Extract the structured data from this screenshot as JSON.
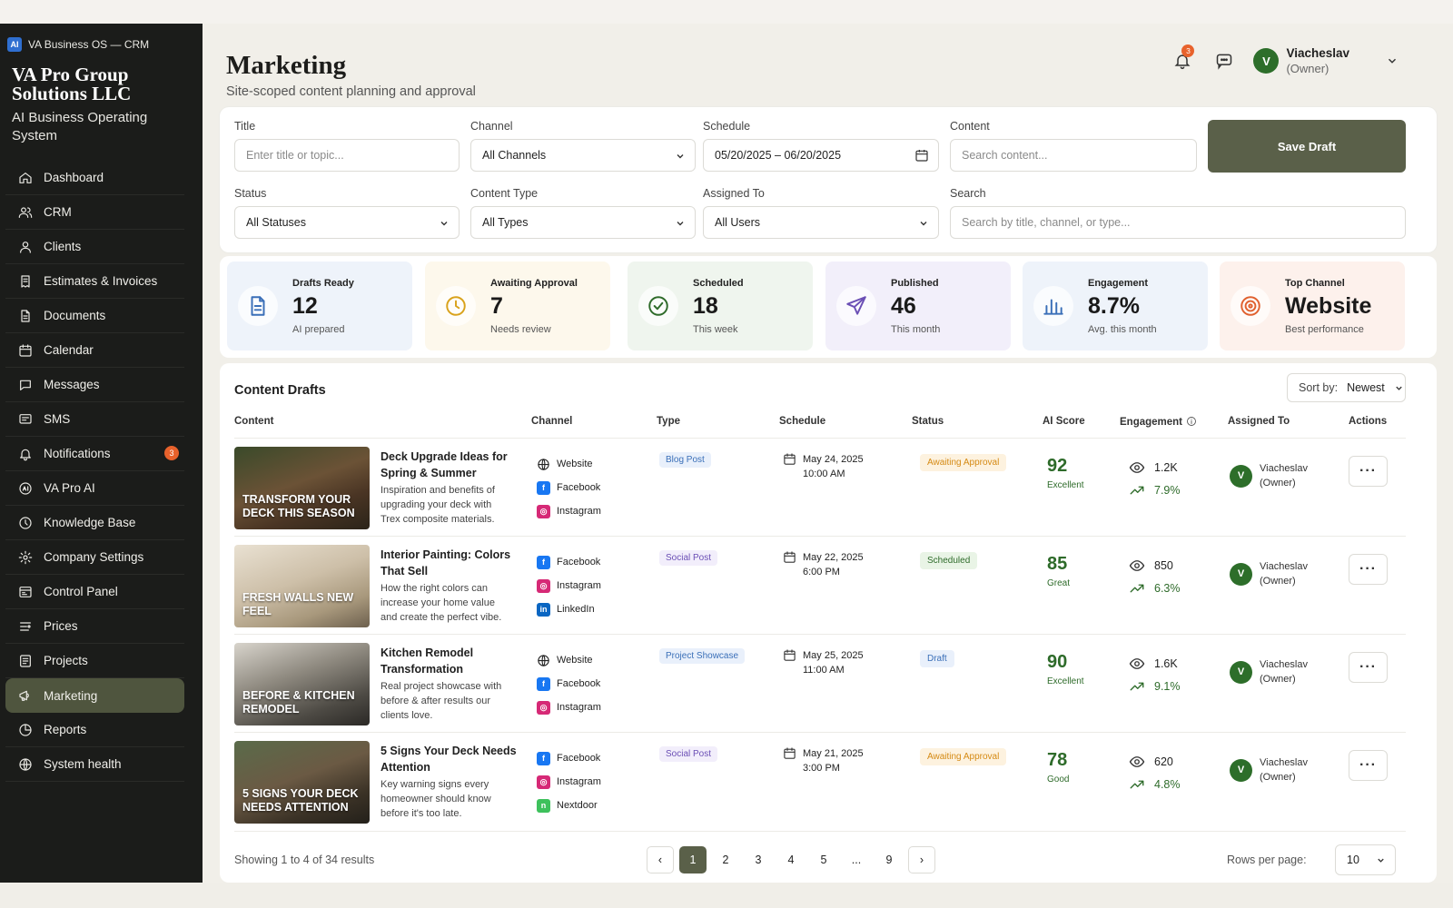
{
  "app": {
    "title": "VA Business OS — CRM",
    "logo_text": "AI",
    "company": "VA Pro Group Solutions LLC",
    "tagline": "AI Business Operating System"
  },
  "sidebar": {
    "items": [
      {
        "label": "Dashboard",
        "icon": "home-icon"
      },
      {
        "label": "CRM",
        "icon": "users-icon"
      },
      {
        "label": "Clients",
        "icon": "clients-icon"
      },
      {
        "label": "Estimates & Invoices",
        "icon": "invoice-icon"
      },
      {
        "label": "Documents",
        "icon": "document-icon"
      },
      {
        "label": "Calendar",
        "icon": "calendar-icon"
      },
      {
        "label": "Messages",
        "icon": "message-icon"
      },
      {
        "label": "SMS",
        "icon": "sms-icon"
      },
      {
        "label": "Notifications",
        "icon": "bell-icon",
        "badge": "3"
      },
      {
        "label": "VA Pro AI",
        "icon": "ai-icon"
      },
      {
        "label": "Knowledge Base",
        "icon": "knowledge-icon"
      },
      {
        "label": "Company Settings",
        "icon": "gear-icon"
      },
      {
        "label": "Control Panel",
        "icon": "control-icon"
      },
      {
        "label": "Prices",
        "icon": "prices-icon"
      },
      {
        "label": "Projects",
        "icon": "projects-icon"
      },
      {
        "label": "Marketing",
        "icon": "megaphone-icon",
        "active": true
      },
      {
        "label": "Reports",
        "icon": "reports-icon"
      },
      {
        "label": "System health",
        "icon": "health-icon"
      }
    ]
  },
  "header": {
    "title": "Marketing",
    "subtitle": "Site-scoped content planning and approval",
    "notif_count": "3",
    "user_initial": "V",
    "user_name": "Viacheslav",
    "user_role": "(Owner)"
  },
  "filters": {
    "title_label": "Title",
    "title_placeholder": "Enter title or topic...",
    "channel_label": "Channel",
    "channel_value": "All Channels",
    "schedule_label": "Schedule",
    "schedule_value": "05/20/2025 – 06/20/2025",
    "content_label": "Content",
    "content_placeholder": "Search content...",
    "status_label": "Status",
    "status_value": "All Statuses",
    "type_label": "Content Type",
    "type_value": "All Types",
    "assigned_label": "Assigned To",
    "assigned_value": "All Users",
    "search_label": "Search",
    "search_placeholder": "Search by title, channel, or type...",
    "save_label": "Save Draft"
  },
  "stats": [
    {
      "label": "Drafts Ready",
      "value": "12",
      "sub": "AI prepared",
      "icon": "document-icon",
      "bg": "#eef3fa",
      "ic": "#3a6fb8"
    },
    {
      "label": "Awaiting Approval",
      "value": "7",
      "sub": "Needs review",
      "icon": "clock-icon",
      "bg": "#fdf8ec",
      "ic": "#d9a21b"
    },
    {
      "label": "Scheduled",
      "value": "18",
      "sub": "This week",
      "icon": "check-circle-icon",
      "bg": "#eff5ee",
      "ic": "#2e6b2a"
    },
    {
      "label": "Published",
      "value": "46",
      "sub": "This month",
      "icon": "send-icon",
      "bg": "#f2effa",
      "ic": "#6b4fb5"
    },
    {
      "label": "Engagement",
      "value": "8.7%",
      "sub": "Avg. this month",
      "icon": "bar-chart-icon",
      "bg": "#eef3fa",
      "ic": "#3a6fb8"
    },
    {
      "label": "Top Channel",
      "value": "Website",
      "sub": "Best performance",
      "icon": "target-icon",
      "bg": "#fdf1ec",
      "ic": "#e0602e"
    }
  ],
  "table": {
    "title": "Content Drafts",
    "sort_label": "Sort by:",
    "sort_value": "Newest",
    "columns": [
      "Content",
      "Channel",
      "Type",
      "Schedule",
      "Status",
      "AI Score",
      "Engagement",
      "Assigned To",
      "Actions"
    ],
    "rows": [
      {
        "thumb_text": "Transform your deck this season",
        "title": "Deck Upgrade Ideas for Spring & Summer",
        "desc": "Inspiration and benefits of upgrading your deck with Trex composite materials.",
        "channels": [
          {
            "name": "Website",
            "icon": "globe-icon"
          },
          {
            "name": "Facebook",
            "icon": "facebook-icon"
          },
          {
            "name": "Instagram",
            "icon": "instagram-icon"
          }
        ],
        "type": "Blog Post",
        "date": "May 24, 2025",
        "time": "10:00 AM",
        "status": "Awaiting Approval",
        "score": "92",
        "score_label": "Excellent",
        "views": "1.2K",
        "rate": "7.9%",
        "assignee": "Viacheslav",
        "role": "(Owner)",
        "initial": "V"
      },
      {
        "thumb_text": "Fresh walls new feel",
        "title": "Interior Painting: Colors That Sell",
        "desc": "How the right colors can increase your home value and create the perfect vibe.",
        "channels": [
          {
            "name": "Facebook",
            "icon": "facebook-icon"
          },
          {
            "name": "Instagram",
            "icon": "instagram-icon"
          },
          {
            "name": "LinkedIn",
            "icon": "linkedin-icon"
          }
        ],
        "type": "Social Post",
        "date": "May 22, 2025",
        "time": "6:00 PM",
        "status": "Scheduled",
        "score": "85",
        "score_label": "Great",
        "views": "850",
        "rate": "6.3%",
        "assignee": "Viacheslav",
        "role": "(Owner)",
        "initial": "V"
      },
      {
        "thumb_text": "Before & kitchen remodel",
        "title": "Kitchen Remodel Transformation",
        "desc": "Real project showcase with before & after results our clients love.",
        "channels": [
          {
            "name": "Website",
            "icon": "globe-icon"
          },
          {
            "name": "Facebook",
            "icon": "facebook-icon"
          },
          {
            "name": "Instagram",
            "icon": "instagram-icon"
          }
        ],
        "type": "Project Showcase",
        "date": "May 25, 2025",
        "time": "11:00 AM",
        "status": "Draft",
        "score": "90",
        "score_label": "Excellent",
        "views": "1.6K",
        "rate": "9.1%",
        "assignee": "Viacheslav",
        "role": "(Owner)",
        "initial": "V"
      },
      {
        "thumb_text": "5 signs your deck needs attention",
        "title": "5 Signs Your Deck Needs Attention",
        "desc": "Key warning signs every homeowner should know before it's too late.",
        "channels": [
          {
            "name": "Facebook",
            "icon": "facebook-icon"
          },
          {
            "name": "Instagram",
            "icon": "instagram-icon"
          },
          {
            "name": "Nextdoor",
            "icon": "nextdoor-icon"
          }
        ],
        "type": "Social Post",
        "date": "May 21, 2025",
        "time": "3:00 PM",
        "status": "Awaiting Approval",
        "score": "78",
        "score_label": "Good",
        "views": "620",
        "rate": "4.8%",
        "assignee": "Viacheslav",
        "role": "(Owner)",
        "initial": "V"
      }
    ],
    "action_label": "···",
    "showing": "Showing 1 to 4 of 34 results",
    "pages": [
      "1",
      "2",
      "3",
      "4",
      "5",
      "...",
      "9"
    ],
    "prev_label": "‹",
    "next_label": "›",
    "rows_label": "Rows per page:",
    "rows_value": "10"
  }
}
